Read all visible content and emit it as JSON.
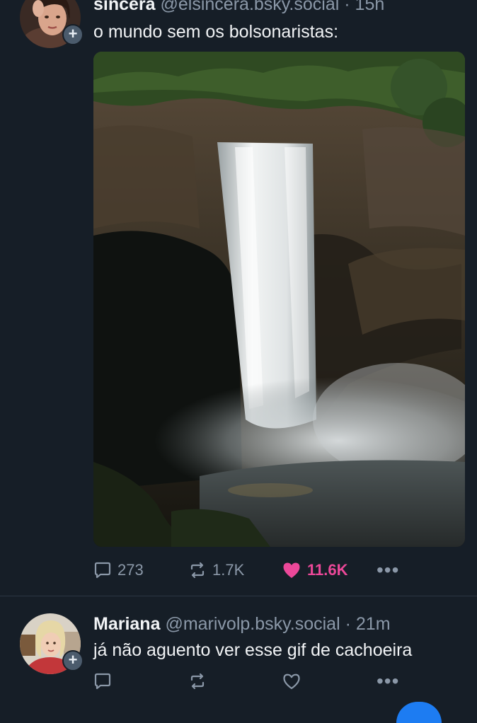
{
  "posts": [
    {
      "display_name": "sincera",
      "handle": "@elsincera.bsky.social",
      "separator": "·",
      "time": "15h",
      "text": "o mundo sem os bolsonaristas:",
      "follow_badge": "+",
      "avatar_icon": "avatar-photo",
      "media_icon": "waterfall-gif",
      "stats": {
        "replies": "273",
        "reposts": "1.7K",
        "likes": "11.6K",
        "liked": true
      },
      "more": "•••"
    },
    {
      "display_name": "Mariana",
      "handle": "@marivolp.bsky.social",
      "separator": "·",
      "time": "21m",
      "text": "já não aguento ver esse gif de cachoeira",
      "follow_badge": "+",
      "avatar_icon": "avatar-photo",
      "stats": {
        "replies": "",
        "reposts": "",
        "likes": "",
        "liked": false
      },
      "more": "•••"
    }
  ],
  "colors": {
    "background": "#161e27",
    "text": "#f1f3f5",
    "muted": "#8b98a8",
    "like": "#ec4899",
    "accent": "#1d7cf2"
  }
}
